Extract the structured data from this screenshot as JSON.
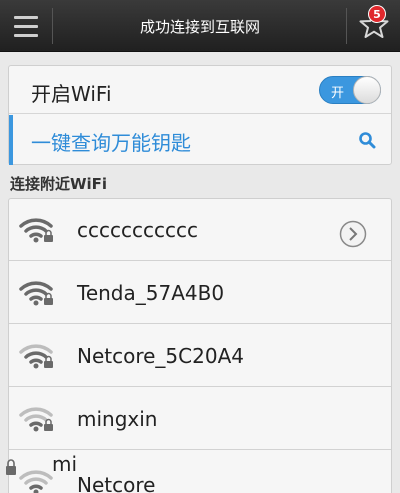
{
  "topbar": {
    "title": "成功连接到互联网",
    "badge_count": "5"
  },
  "settings": {
    "wifi_label": "开启WiFi",
    "toggle_text": "开",
    "toggle_on": true,
    "search_label": "一键查询万能钥匙"
  },
  "section": {
    "title": "连接附近WiFi"
  },
  "networks": [
    {
      "name": "ccccccccccc",
      "locked": true,
      "signal": "strong"
    },
    {
      "name": "Tenda_57A4B0",
      "locked": true,
      "signal": "strong"
    },
    {
      "name": "Netcore_5C20A4",
      "locked": true,
      "signal": "medium"
    },
    {
      "name": "mingxin",
      "locked": true,
      "signal": "weak"
    },
    {
      "name": "Netcore",
      "locked": true,
      "signal": "weak"
    }
  ],
  "overlay": {
    "text": "mi"
  },
  "colors": {
    "accent": "#3b97df",
    "topbar": "#2a2a2a",
    "badge": "#e0282d"
  }
}
